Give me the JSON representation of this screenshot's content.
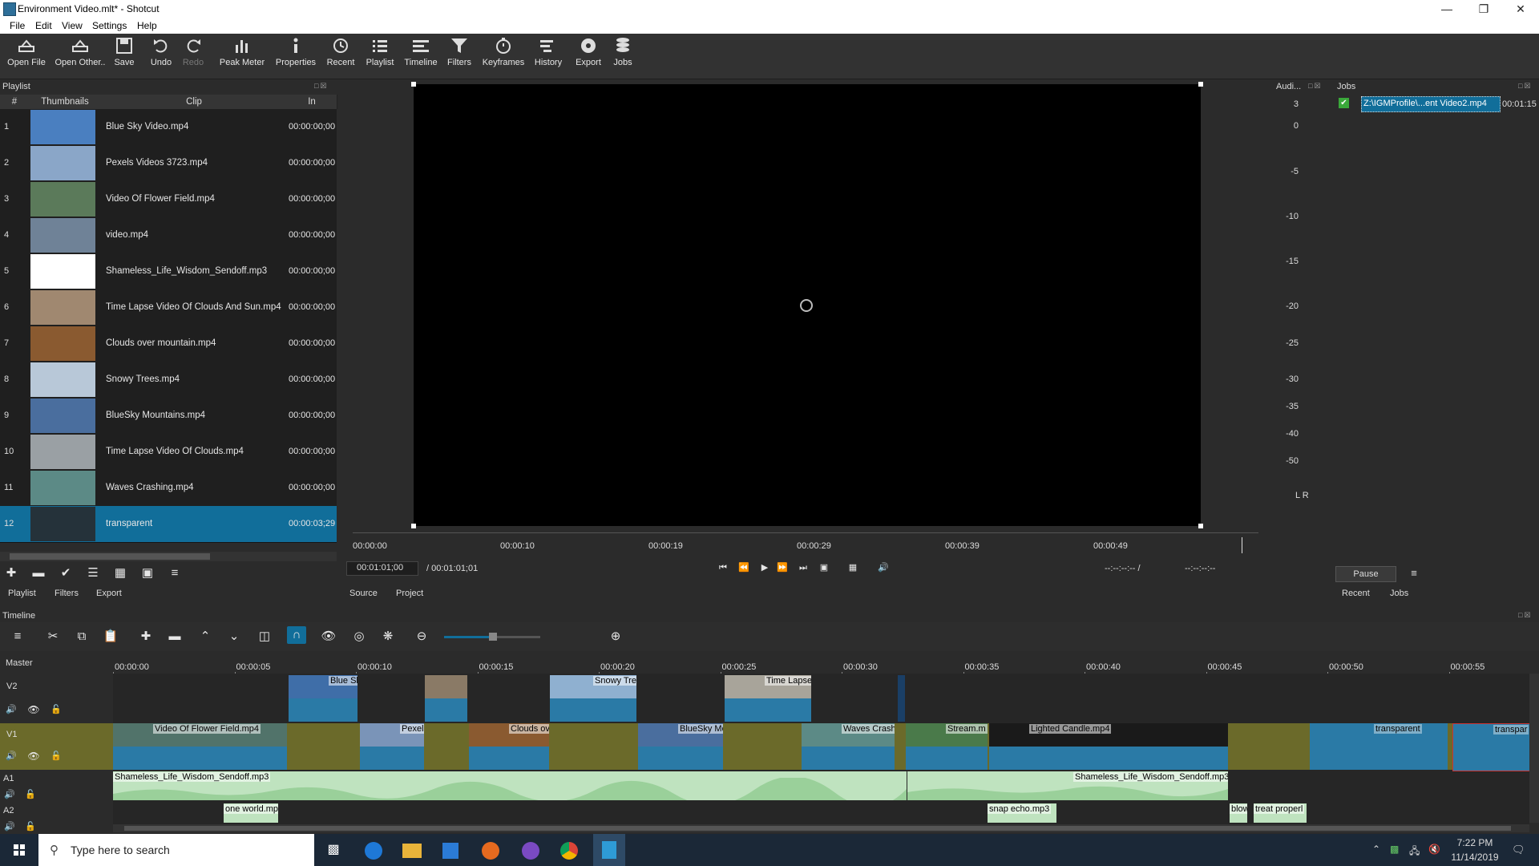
{
  "window": {
    "title": "Environment Video.mlt* - Shotcut"
  },
  "menu": [
    "File",
    "Edit",
    "View",
    "Settings",
    "Help"
  ],
  "toolbar": [
    {
      "label": "Open File",
      "icon": "open-file-icon"
    },
    {
      "label": "Open Other..",
      "icon": "open-other-icon"
    },
    {
      "label": "Save",
      "icon": "save-icon"
    },
    {
      "label": "Undo",
      "icon": "undo-icon"
    },
    {
      "label": "Redo",
      "icon": "redo-icon"
    },
    {
      "label": "Peak Meter",
      "icon": "peak-meter-icon"
    },
    {
      "label": "Properties",
      "icon": "properties-icon"
    },
    {
      "label": "Recent",
      "icon": "recent-icon"
    },
    {
      "label": "Playlist",
      "icon": "playlist-icon"
    },
    {
      "label": "Timeline",
      "icon": "timeline-icon"
    },
    {
      "label": "Filters",
      "icon": "filters-icon"
    },
    {
      "label": "Keyframes",
      "icon": "keyframes-icon"
    },
    {
      "label": "History",
      "icon": "history-icon"
    },
    {
      "label": "Export",
      "icon": "export-icon"
    },
    {
      "label": "Jobs",
      "icon": "jobs-icon"
    }
  ],
  "playlist": {
    "title": "Playlist",
    "columns": [
      "#",
      "Thumbnails",
      "Clip",
      "In"
    ],
    "rows": [
      {
        "num": "1",
        "clip": "Blue Sky Video.mp4",
        "in": "00:00:00;00",
        "thumb": "#4a7fc0"
      },
      {
        "num": "2",
        "clip": "Pexels Videos 3723.mp4",
        "in": "00:00:00;00",
        "thumb": "#8aa6c8"
      },
      {
        "num": "3",
        "clip": "Video Of Flower Field.mp4",
        "in": "00:00:00;00",
        "thumb": "#5b7a5a"
      },
      {
        "num": "4",
        "clip": "video.mp4",
        "in": "00:00:00;00",
        "thumb": "#6f8297"
      },
      {
        "num": "5",
        "clip": "Shameless_Life_Wisdom_Sendoff.mp3",
        "in": "00:00:00;00",
        "thumb": "#ffffff"
      },
      {
        "num": "6",
        "clip": "Time Lapse Video Of Clouds And Sun.mp4",
        "in": "00:00:00;00",
        "thumb": "#a08870"
      },
      {
        "num": "7",
        "clip": "Clouds over mountain.mp4",
        "in": "00:00:00;00",
        "thumb": "#8a5a30"
      },
      {
        "num": "8",
        "clip": "Snowy Trees.mp4",
        "in": "00:00:00;00",
        "thumb": "#b8c8d8"
      },
      {
        "num": "9",
        "clip": "BlueSky Mountains.mp4",
        "in": "00:00:00;00",
        "thumb": "#4a6e9e"
      },
      {
        "num": "10",
        "clip": "Time Lapse Video Of Clouds.mp4",
        "in": "00:00:00;00",
        "thumb": "#9aa0a4"
      },
      {
        "num": "11",
        "clip": "Waves Crashing.mp4",
        "in": "00:00:00;00",
        "thumb": "#5c8a86"
      },
      {
        "num": "12",
        "clip": "transparent",
        "in": "00:00:03;29",
        "thumb": "#25323a",
        "selected": true
      }
    ],
    "bottom_tabs": [
      "Playlist",
      "Filters",
      "Export"
    ]
  },
  "player": {
    "ruler": [
      "00:00:00",
      "00:00:10",
      "00:00:19",
      "00:00:29",
      "00:00:39",
      "00:00:49"
    ],
    "current_time": "00:01:01;00",
    "duration": "/ 00:01:01;01",
    "in_point": "--:--:--:-- /",
    "out_point": "--:--:--:--",
    "tabs": [
      "Source",
      "Project"
    ]
  },
  "audio_meter": {
    "title": "Audi...",
    "levels": [
      "3",
      "0",
      "-5",
      "-10",
      "-15",
      "-20",
      "-25",
      "-30",
      "-35",
      "-40",
      "-50"
    ],
    "channels": "L  R"
  },
  "jobs": {
    "title": "Jobs",
    "job_name": "Z:\\IGMProfile\\...ent Video2.mp4",
    "job_time": "00:01:15",
    "pause_label": "Pause",
    "tabs": [
      "Recent",
      "Jobs"
    ]
  },
  "timeline": {
    "title": "Timeline",
    "tracks": [
      "Master",
      "V2",
      "V1",
      "A1",
      "A2"
    ],
    "ruler": [
      "00:00:00",
      "00:00:05",
      "00:00:10",
      "00:00:15",
      "00:00:20",
      "00:00:25",
      "00:00:30",
      "00:00:35",
      "00:00:40",
      "00:00:45",
      "00:00:50",
      "00:00:55"
    ],
    "v2_clips": [
      "Blue Sk",
      "",
      "Snowy Tree",
      "Time Lapse"
    ],
    "v1_clips": [
      "Video Of Flower Field.mp4",
      "Pexels",
      "Clouds ov",
      "BlueSky Mo",
      "Waves Crashi",
      "Stream.m",
      "Lighted Candle.mp4",
      "transparent",
      "transpar"
    ],
    "a1_clips": [
      "Shameless_Life_Wisdom_Sendoff.mp3",
      "Shameless_Life_Wisdom_Sendoff.mp3"
    ],
    "a2_clips": [
      "one world.mp",
      "snap echo.mp3",
      "blow",
      "treat properl"
    ]
  },
  "taskbar": {
    "search_placeholder": "Type here to search",
    "time": "7:22 PM",
    "date": "11/14/2019"
  }
}
